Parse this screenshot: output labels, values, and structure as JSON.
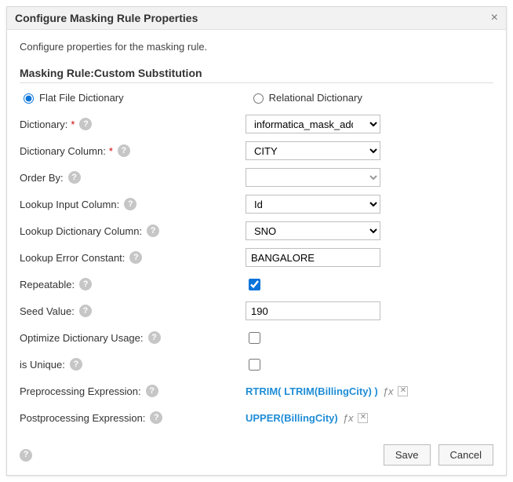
{
  "header": {
    "title": "Configure Masking Rule Properties"
  },
  "subtitle": "Configure properties for the masking rule.",
  "section_title": "Masking Rule:Custom Substitution",
  "radios": {
    "flat_file": "Flat File Dictionary",
    "relational": "Relational Dictionary"
  },
  "fields": {
    "dictionary": {
      "label": "Dictionary:",
      "value": "informatica_mask_addre"
    },
    "dictionary_column": {
      "label": "Dictionary Column:",
      "value": "CITY"
    },
    "order_by": {
      "label": "Order By:",
      "value": ""
    },
    "lookup_input_column": {
      "label": "Lookup Input Column:",
      "value": "Id"
    },
    "lookup_dict_column": {
      "label": "Lookup Dictionary Column:",
      "value": "SNO"
    },
    "lookup_error_constant": {
      "label": "Lookup Error Constant:",
      "value": "BANGALORE"
    },
    "repeatable": {
      "label": "Repeatable:"
    },
    "seed_value": {
      "label": "Seed Value:",
      "value": "190"
    },
    "optimize_dict_usage": {
      "label": "Optimize Dictionary Usage:"
    },
    "is_unique": {
      "label": "is Unique:"
    },
    "preprocessing": {
      "label": "Preprocessing Expression:",
      "value": "RTRIM( LTRIM(BillingCity) )"
    },
    "postprocessing": {
      "label": "Postprocessing Expression:",
      "value": "UPPER(BillingCity)"
    }
  },
  "buttons": {
    "save": "Save",
    "cancel": "Cancel"
  }
}
